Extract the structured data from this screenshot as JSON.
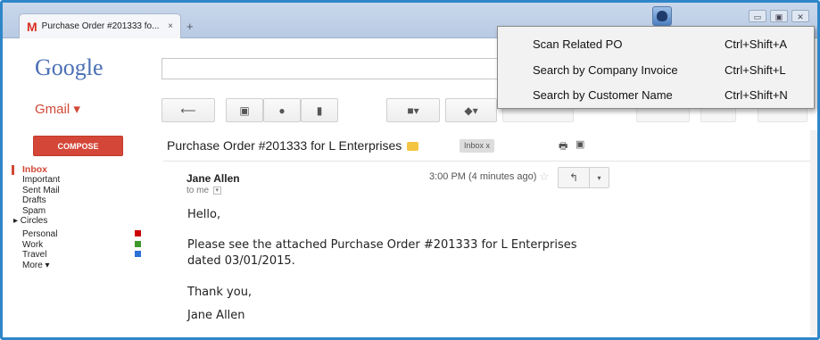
{
  "browser": {
    "tab_title": "Purchase Order #201333 fo...",
    "tab_favicon": "M",
    "tab_close": "×",
    "new_tab": "+",
    "window_controls": [
      "▭",
      "▣",
      "✕"
    ]
  },
  "header": {
    "logo": "Google",
    "search_value": ""
  },
  "gmail": {
    "label": "Gmail ▾",
    "toolbar": {
      "back_icon": "⟵",
      "archive_icon": "▣",
      "spam_icon": "●",
      "delete_icon": "▮",
      "folder_icon": "■▾",
      "tag_icon": "◆▾"
    }
  },
  "nav": {
    "compose": "COMPOSE",
    "items": [
      {
        "label": "Inbox"
      },
      {
        "label": "Important"
      },
      {
        "label": "Sent Mail"
      },
      {
        "label": "Drafts"
      },
      {
        "label": "Spam"
      },
      {
        "label": "▸ Circles"
      },
      {
        "label": "Personal",
        "color": "#cc0000"
      },
      {
        "label": "Work",
        "color": "#3d9a2a"
      },
      {
        "label": "Travel",
        "color": "#2a6fd6"
      },
      {
        "label": "More ▾"
      }
    ]
  },
  "message": {
    "subject": "Purchase Order #201333 for L Enterprises",
    "label_color": "#f4c542",
    "inbox_chip": "Inbox  x",
    "sender": "Jane Allen",
    "to": "to me",
    "time": "3:00 PM (4 minutes ago)",
    "star": "☆",
    "reply_icon": "↰",
    "more_icon": "▾",
    "body": [
      "Hello,",
      "Please see the attached Purchase Order #201333 for L Enterprises",
      "dated 03/01/2015.",
      "Thank you,",
      "Jane Allen"
    ]
  },
  "context_menu": {
    "items": [
      {
        "label": "Scan Related PO",
        "shortcut": "Ctrl+Shift+A"
      },
      {
        "label": "Search by Company Invoice",
        "shortcut": "Ctrl+Shift+L"
      },
      {
        "label": "Search by Customer Name",
        "shortcut": "Ctrl+Shift+N"
      }
    ]
  },
  "colors": {
    "frame": "#2e86c8",
    "compose": "#d44637",
    "gmail_red": "#d14836",
    "menu_bg": "#f2f2f2"
  }
}
